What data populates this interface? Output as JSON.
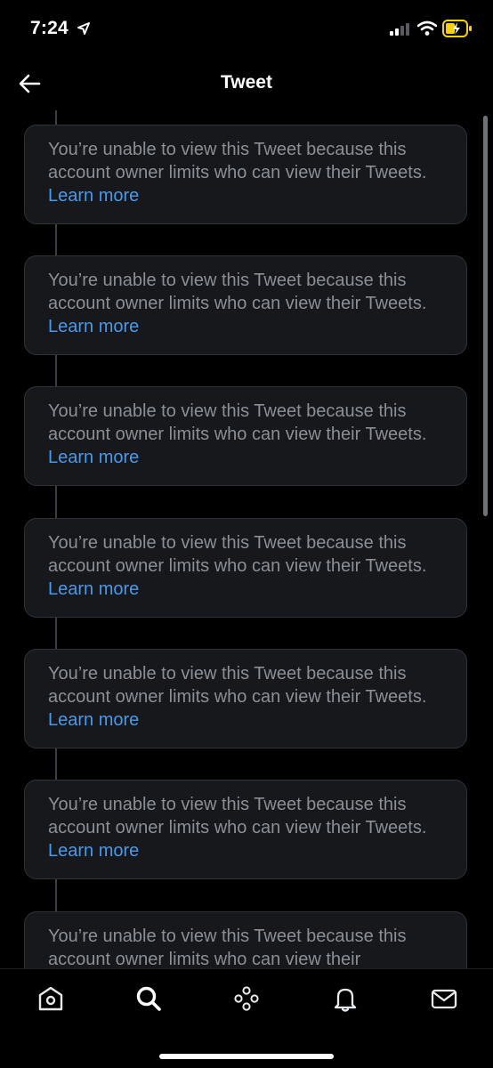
{
  "status_bar": {
    "time": "7:24"
  },
  "header": {
    "title": "Tweet"
  },
  "cards": [
    {
      "text": "You’re unable to view this Tweet because this account owner limits who can view their Tweets.",
      "link": "Learn more"
    },
    {
      "text": "You’re unable to view this Tweet because this account owner limits who can view their Tweets.",
      "link": "Learn more"
    },
    {
      "text": "You’re unable to view this Tweet because this account owner limits who can view their Tweets.",
      "link": "Learn more"
    },
    {
      "text": "You’re unable to view this Tweet because this account owner limits who can view their Tweets.",
      "link": "Learn more"
    },
    {
      "text": "You’re unable to view this Tweet because this account owner limits who can view their Tweets.",
      "link": "Learn more"
    },
    {
      "text": "You’re unable to view this Tweet because this account owner limits who can view their Tweets.",
      "link": "Learn more"
    },
    {
      "text": "You’re unable to view this Tweet because this account owner limits who can view their",
      "link": ""
    }
  ],
  "tabs": [
    {
      "icon": "home-icon"
    },
    {
      "icon": "search-icon"
    },
    {
      "icon": "spaces-icon"
    },
    {
      "icon": "notifications-bell-icon"
    },
    {
      "icon": "messages-envelope-icon"
    }
  ],
  "colors": {
    "background": "#000000",
    "card": "#16181c",
    "card_border": "#2f3336",
    "muted_text": "#8b8f94",
    "link": "#4a99e9",
    "battery": "#f5d20b"
  }
}
